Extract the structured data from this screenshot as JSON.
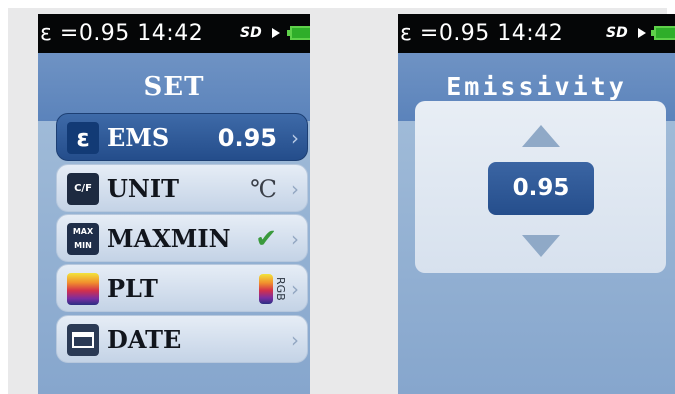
{
  "status": {
    "text": "ε =0.95 14:42",
    "sd_icon": "sd-card-icon",
    "battery_icon": "battery-icon",
    "colors": {
      "bar": "#050607",
      "battery": "#2fae2a"
    }
  },
  "left_screen": {
    "title": "SET",
    "items": [
      {
        "icon_text": "ε",
        "icon": "emissivity-icon",
        "label": "EMS",
        "value": "0.95",
        "selected": true
      },
      {
        "icon_text": "C/F",
        "icon": "unit-icon",
        "label": "UNIT",
        "value": "℃"
      },
      {
        "icon_text": "MAX MIN",
        "icon": "maxmin-icon",
        "label": "MAXMIN",
        "value": "✔"
      },
      {
        "icon_text": "RGB",
        "icon": "palette-icon",
        "label": "PLT",
        "value": "RGB"
      },
      {
        "icon_text": "",
        "icon": "calendar-icon",
        "label": "DATE",
        "value": ""
      }
    ],
    "chevron": "›"
  },
  "right_screen": {
    "title": "Emissivity",
    "value": "0.95",
    "up_icon": "arrow-up-icon",
    "down_icon": "arrow-down-icon"
  },
  "colors": {
    "accent": "#2b5596",
    "header": "#5b83bb",
    "background": "#e9e9ea"
  }
}
